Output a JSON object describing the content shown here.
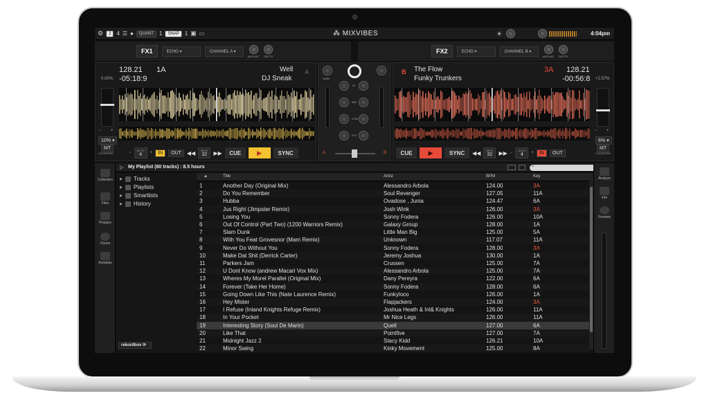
{
  "topbar": {
    "layout_num_a": "2",
    "layout_num_b": "4",
    "quant_label": "QUANT",
    "quant_value": "1",
    "snap_label": "SNAP",
    "snap_value": "1",
    "logo_text": "MIXVIBES",
    "clock": "4:04pm"
  },
  "fx1": {
    "label": "FX1",
    "effect": "ECHO",
    "channel": "CHANNEL A",
    "knob1": "AMOUNT",
    "knob2": "DEPTH"
  },
  "fx2": {
    "label": "FX2",
    "effect": "ECHO",
    "channel": "CHANNEL B",
    "knob1": "AMOUNT",
    "knob2": "DEPTH"
  },
  "deck_a": {
    "letter": "A",
    "bpm": "128.21",
    "key": "1A",
    "time": "-05:18:9",
    "pitch": "0.00%",
    "title": "Well",
    "artist": "DJ Sneak",
    "range": "10%",
    "mode": "MT",
    "locators": "LOCATORS",
    "auto_label": "AUTO",
    "auto_value": "4",
    "in": "IN",
    "out": "OUT",
    "beat_label": "BEAT",
    "beat_value": "32",
    "cue": "CUE",
    "sync": "SYNC",
    "accent": "#f2c230"
  },
  "deck_b": {
    "letter": "B",
    "bpm": "128.21",
    "key": "3A",
    "time": "-00:56:8",
    "pitch": "+2.57%",
    "title": "The Flow",
    "artist": "Funky Trunkers",
    "range": "6%",
    "mode": "MT",
    "locators": "LOCATORS",
    "auto_label": "AUTO",
    "auto_value": "4",
    "in": "IN",
    "out": "OUT",
    "beat_label": "BEAT",
    "beat_value": "32",
    "cue": "CUE",
    "sync": "SYNC",
    "accent": "#e84a3a"
  },
  "mixer": {
    "gain": "GAIN",
    "hi": "HI",
    "mid": "MID",
    "low": "LOW",
    "filt": "FILT",
    "xfader_a": "A",
    "xfader_b": "B"
  },
  "browser": {
    "playlist_title": "My Playlist (80 tracks) : 8.5 hours",
    "left_icons": [
      "Collection",
      "Files",
      "Prepare",
      "iTunes",
      "Autoplay"
    ],
    "right_icons": [
      "Analyze",
      "Info",
      "Preview"
    ],
    "tree": [
      "Tracks",
      "Playlists",
      "Smartlists",
      "History"
    ],
    "rekordbox": "rekordbox",
    "columns": {
      "title": "Title",
      "artist": "Artist",
      "bpm": "BPM",
      "key": "Key"
    },
    "rows": [
      {
        "n": "1",
        "title": "Another Day (Original Mix)",
        "artist": "Alessandro Arbola",
        "bpm": "124.00",
        "key": "3A",
        "red": true
      },
      {
        "n": "2",
        "title": "Do You Remember",
        "artist": "Soul Revenger",
        "bpm": "127.05",
        "key": "11A",
        "red": false
      },
      {
        "n": "3",
        "title": "Hubba",
        "artist": "Ovadose , Junia",
        "bpm": "124.47",
        "key": "6A",
        "red": false
      },
      {
        "n": "4",
        "title": "Jus Right (Jimpster Remix)",
        "artist": "Josh Wink",
        "bpm": "126.00",
        "key": "3A",
        "red": true
      },
      {
        "n": "5",
        "title": "Losing You",
        "artist": "Sonny Fodera",
        "bpm": "126.00",
        "key": "10A",
        "red": false
      },
      {
        "n": "6",
        "title": "Out Of Control (Part Two) (1200 Warriors Remix)",
        "artist": "Galaxy Group",
        "bpm": "128.00",
        "key": "1A",
        "red": false
      },
      {
        "n": "7",
        "title": "Slam Dunk",
        "artist": "Little Man Big",
        "bpm": "125.00",
        "key": "5A",
        "red": false
      },
      {
        "n": "8",
        "title": "With You Feat Grovesnor (Mam Remix)",
        "artist": "Unknown",
        "bpm": "117.07",
        "key": "11A",
        "red": false
      },
      {
        "n": "9",
        "title": "Never Do Without You",
        "artist": "Sonny Fodera",
        "bpm": "128.00",
        "key": "3A",
        "red": true
      },
      {
        "n": "10",
        "title": "Make Dat Shit (Derrick Carter)",
        "artist": "Jeremy Joshua",
        "bpm": "130.00",
        "key": "1A",
        "red": false
      },
      {
        "n": "11",
        "title": "Parkers Jam",
        "artist": "Crussen",
        "bpm": "125.00",
        "key": "7A",
        "red": false
      },
      {
        "n": "12",
        "title": "U Dont Know (andrew Macari Vox Mix)",
        "artist": "Alessandro Arbola",
        "bpm": "125.00",
        "key": "7A",
        "red": false
      },
      {
        "n": "13",
        "title": "Wheres My Morel Parallel (Original Mix)",
        "artist": "Dany Pereyra",
        "bpm": "122.00",
        "key": "6A",
        "red": false
      },
      {
        "n": "14",
        "title": "Forever (Take Her Home)",
        "artist": "Sonny Fodera",
        "bpm": "128.00",
        "key": "6A",
        "red": false
      },
      {
        "n": "15",
        "title": "Going Down Like This (Nate Laurence Remix)",
        "artist": "Funkyloco",
        "bpm": "126.00",
        "key": "1A",
        "red": false
      },
      {
        "n": "16",
        "title": "Hey Mister",
        "artist": "Flapjackers",
        "bpm": "124.00",
        "key": "3A",
        "red": true
      },
      {
        "n": "17",
        "title": "I Refuse (Inland Knights Refuge Remix)",
        "artist": "Joshua Heath & Inl& Knights",
        "bpm": "126.00",
        "key": "11A",
        "red": false
      },
      {
        "n": "18",
        "title": "In Your Pocket",
        "artist": "Mr Nice Legs",
        "bpm": "126.00",
        "key": "11A",
        "red": false
      },
      {
        "n": "19",
        "title": "Interesting Story (Soul De Marin)",
        "artist": "Quell",
        "bpm": "127.00",
        "key": "6A",
        "red": false,
        "selected": true
      },
      {
        "n": "20",
        "title": "Like That",
        "artist": "Pointfive",
        "bpm": "127.00",
        "key": "7A",
        "red": false
      },
      {
        "n": "21",
        "title": "Midnight Jazz 2",
        "artist": "Stacy Kidd",
        "bpm": "126.21",
        "key": "10A",
        "red": false
      },
      {
        "n": "22",
        "title": "Minor Swing",
        "artist": "Kinky Movement",
        "bpm": "125.00",
        "key": "8A",
        "red": false
      }
    ]
  }
}
